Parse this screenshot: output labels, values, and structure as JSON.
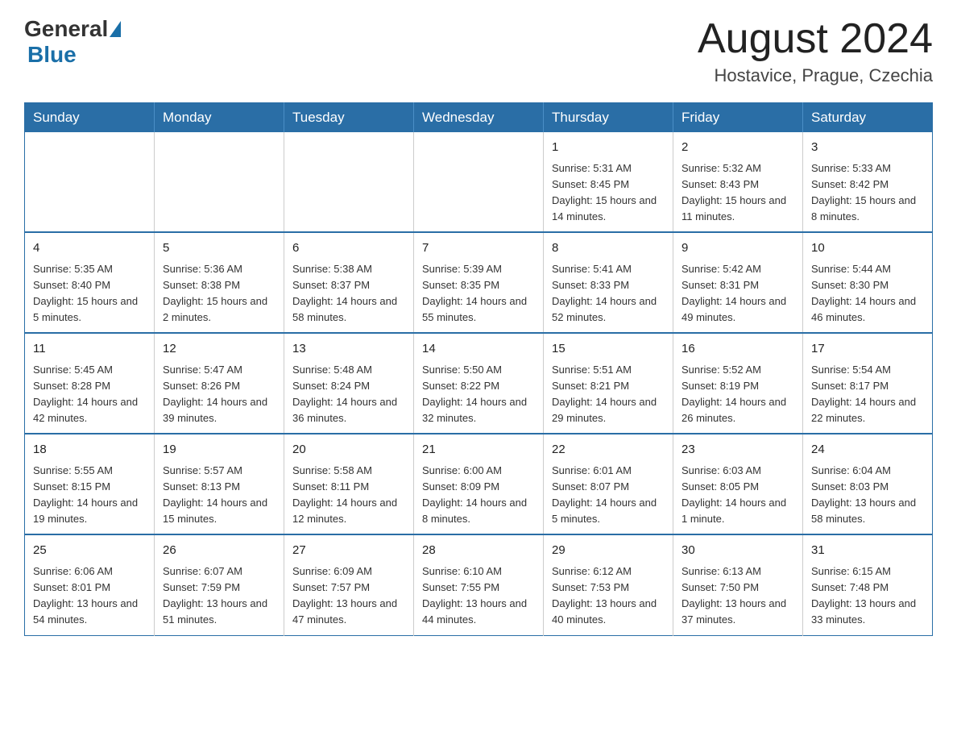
{
  "header": {
    "logo": {
      "general": "General",
      "blue": "Blue"
    },
    "title": "August 2024",
    "location": "Hostavice, Prague, Czechia"
  },
  "calendar": {
    "headers": [
      "Sunday",
      "Monday",
      "Tuesday",
      "Wednesday",
      "Thursday",
      "Friday",
      "Saturday"
    ],
    "rows": [
      [
        {
          "day": "",
          "info": ""
        },
        {
          "day": "",
          "info": ""
        },
        {
          "day": "",
          "info": ""
        },
        {
          "day": "",
          "info": ""
        },
        {
          "day": "1",
          "info": "Sunrise: 5:31 AM\nSunset: 8:45 PM\nDaylight: 15 hours and 14 minutes."
        },
        {
          "day": "2",
          "info": "Sunrise: 5:32 AM\nSunset: 8:43 PM\nDaylight: 15 hours and 11 minutes."
        },
        {
          "day": "3",
          "info": "Sunrise: 5:33 AM\nSunset: 8:42 PM\nDaylight: 15 hours and 8 minutes."
        }
      ],
      [
        {
          "day": "4",
          "info": "Sunrise: 5:35 AM\nSunset: 8:40 PM\nDaylight: 15 hours and 5 minutes."
        },
        {
          "day": "5",
          "info": "Sunrise: 5:36 AM\nSunset: 8:38 PM\nDaylight: 15 hours and 2 minutes."
        },
        {
          "day": "6",
          "info": "Sunrise: 5:38 AM\nSunset: 8:37 PM\nDaylight: 14 hours and 58 minutes."
        },
        {
          "day": "7",
          "info": "Sunrise: 5:39 AM\nSunset: 8:35 PM\nDaylight: 14 hours and 55 minutes."
        },
        {
          "day": "8",
          "info": "Sunrise: 5:41 AM\nSunset: 8:33 PM\nDaylight: 14 hours and 52 minutes."
        },
        {
          "day": "9",
          "info": "Sunrise: 5:42 AM\nSunset: 8:31 PM\nDaylight: 14 hours and 49 minutes."
        },
        {
          "day": "10",
          "info": "Sunrise: 5:44 AM\nSunset: 8:30 PM\nDaylight: 14 hours and 46 minutes."
        }
      ],
      [
        {
          "day": "11",
          "info": "Sunrise: 5:45 AM\nSunset: 8:28 PM\nDaylight: 14 hours and 42 minutes."
        },
        {
          "day": "12",
          "info": "Sunrise: 5:47 AM\nSunset: 8:26 PM\nDaylight: 14 hours and 39 minutes."
        },
        {
          "day": "13",
          "info": "Sunrise: 5:48 AM\nSunset: 8:24 PM\nDaylight: 14 hours and 36 minutes."
        },
        {
          "day": "14",
          "info": "Sunrise: 5:50 AM\nSunset: 8:22 PM\nDaylight: 14 hours and 32 minutes."
        },
        {
          "day": "15",
          "info": "Sunrise: 5:51 AM\nSunset: 8:21 PM\nDaylight: 14 hours and 29 minutes."
        },
        {
          "day": "16",
          "info": "Sunrise: 5:52 AM\nSunset: 8:19 PM\nDaylight: 14 hours and 26 minutes."
        },
        {
          "day": "17",
          "info": "Sunrise: 5:54 AM\nSunset: 8:17 PM\nDaylight: 14 hours and 22 minutes."
        }
      ],
      [
        {
          "day": "18",
          "info": "Sunrise: 5:55 AM\nSunset: 8:15 PM\nDaylight: 14 hours and 19 minutes."
        },
        {
          "day": "19",
          "info": "Sunrise: 5:57 AM\nSunset: 8:13 PM\nDaylight: 14 hours and 15 minutes."
        },
        {
          "day": "20",
          "info": "Sunrise: 5:58 AM\nSunset: 8:11 PM\nDaylight: 14 hours and 12 minutes."
        },
        {
          "day": "21",
          "info": "Sunrise: 6:00 AM\nSunset: 8:09 PM\nDaylight: 14 hours and 8 minutes."
        },
        {
          "day": "22",
          "info": "Sunrise: 6:01 AM\nSunset: 8:07 PM\nDaylight: 14 hours and 5 minutes."
        },
        {
          "day": "23",
          "info": "Sunrise: 6:03 AM\nSunset: 8:05 PM\nDaylight: 14 hours and 1 minute."
        },
        {
          "day": "24",
          "info": "Sunrise: 6:04 AM\nSunset: 8:03 PM\nDaylight: 13 hours and 58 minutes."
        }
      ],
      [
        {
          "day": "25",
          "info": "Sunrise: 6:06 AM\nSunset: 8:01 PM\nDaylight: 13 hours and 54 minutes."
        },
        {
          "day": "26",
          "info": "Sunrise: 6:07 AM\nSunset: 7:59 PM\nDaylight: 13 hours and 51 minutes."
        },
        {
          "day": "27",
          "info": "Sunrise: 6:09 AM\nSunset: 7:57 PM\nDaylight: 13 hours and 47 minutes."
        },
        {
          "day": "28",
          "info": "Sunrise: 6:10 AM\nSunset: 7:55 PM\nDaylight: 13 hours and 44 minutes."
        },
        {
          "day": "29",
          "info": "Sunrise: 6:12 AM\nSunset: 7:53 PM\nDaylight: 13 hours and 40 minutes."
        },
        {
          "day": "30",
          "info": "Sunrise: 6:13 AM\nSunset: 7:50 PM\nDaylight: 13 hours and 37 minutes."
        },
        {
          "day": "31",
          "info": "Sunrise: 6:15 AM\nSunset: 7:48 PM\nDaylight: 13 hours and 33 minutes."
        }
      ]
    ]
  }
}
